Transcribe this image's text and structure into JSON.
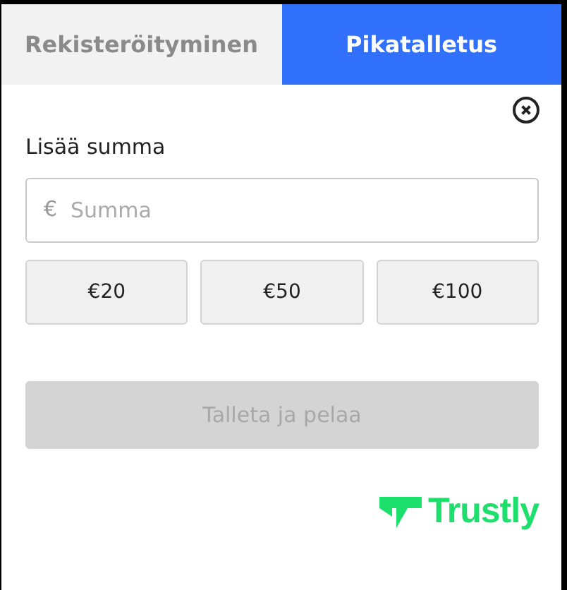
{
  "tabs": [
    {
      "label": "Rekisteröityminen",
      "selected": false
    },
    {
      "label": "Pikatalletus",
      "selected": true
    }
  ],
  "amount": {
    "label": "Lisää summa",
    "currency": "€",
    "placeholder": "Summa"
  },
  "presets": [
    "€20",
    "€50",
    "€100"
  ],
  "submit": {
    "label": "Talleta ja pelaa",
    "disabled": true
  },
  "logo": {
    "text": "Trustly"
  }
}
